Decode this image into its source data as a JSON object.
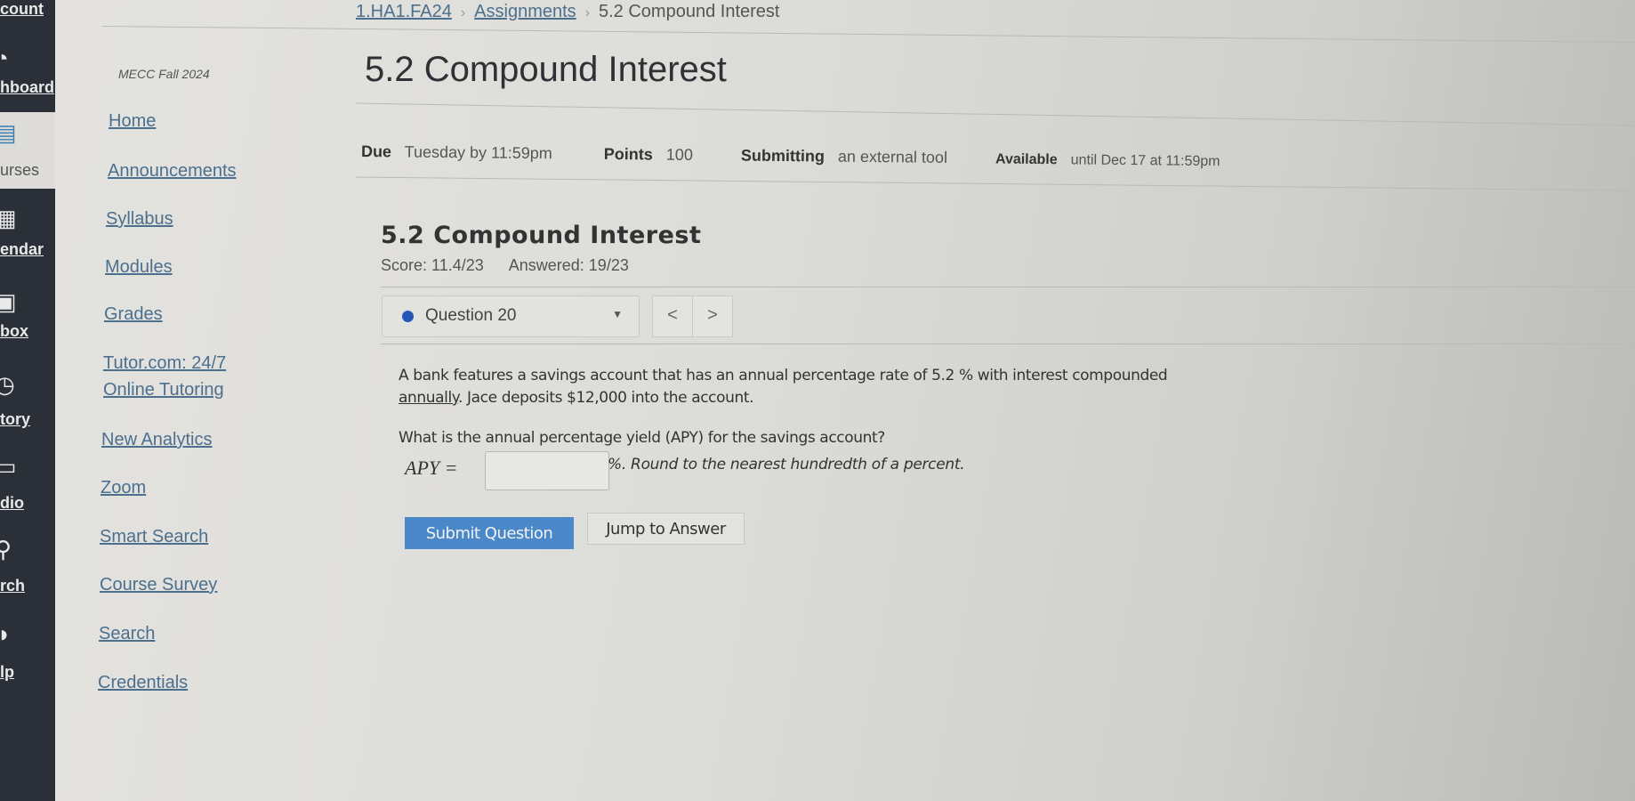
{
  "global_nav": {
    "items": [
      {
        "label": "count",
        "icon": "account-icon"
      },
      {
        "label": "hboard",
        "icon": "dashboard-icon"
      },
      {
        "label": "urses",
        "icon": "courses-icon",
        "active": true
      },
      {
        "label": "endar",
        "icon": "calendar-icon"
      },
      {
        "label": "box",
        "icon": "inbox-icon"
      },
      {
        "label": "tory",
        "icon": "history-icon"
      },
      {
        "label": "dio",
        "icon": "studio-icon"
      },
      {
        "label": "rch",
        "icon": "search-icon"
      },
      {
        "label": "lp",
        "icon": "help-icon"
      }
    ]
  },
  "breadcrumb": {
    "items": [
      "1.HA1.FA24",
      "Assignments",
      "5.2 Compound Interest"
    ]
  },
  "course_nav": {
    "term": "MECC Fall 2024",
    "items": [
      "Home",
      "Announcements",
      "Syllabus",
      "Modules",
      "Grades",
      "Tutor.com: 24/7",
      "Online Tutoring",
      "New Analytics",
      "Zoom",
      "Smart Search",
      "Course Survey",
      "Search",
      "Credentials"
    ]
  },
  "assignment": {
    "title": "5.2 Compound Interest",
    "due_label": "Due",
    "due_value": "Tuesday by 11:59pm",
    "points_label": "Points",
    "points_value": "100",
    "submitting_label": "Submitting",
    "submitting_value": "an external tool",
    "available_label": "Available",
    "available_value": "until Dec 17 at 11:59pm"
  },
  "quiz": {
    "title": "5.2 Compound Interest",
    "score": "Score: 11.4/23",
    "answered": "Answered: 19/23",
    "question_select": "Question 20",
    "prev": "<",
    "next": ">",
    "text_line1": "A bank features a savings account that has an annual percentage rate of 5.2 % with interest compounded",
    "text_line2_underlined": "annually",
    "text_line2_rest": ". Jace deposits $12,000 into the account.",
    "question": "What is the annual percentage yield (APY) for the savings account?",
    "apy_label": "APY =",
    "apy_value": "",
    "hint": "%. Round to the nearest hundredth of a percent.",
    "submit_label": "Submit Question",
    "jump_label": "Jump to Answer"
  },
  "colors": {
    "primary_button": "#4a88c9",
    "status_dot": "#2557b8",
    "nav_bg": "#2b3038"
  }
}
